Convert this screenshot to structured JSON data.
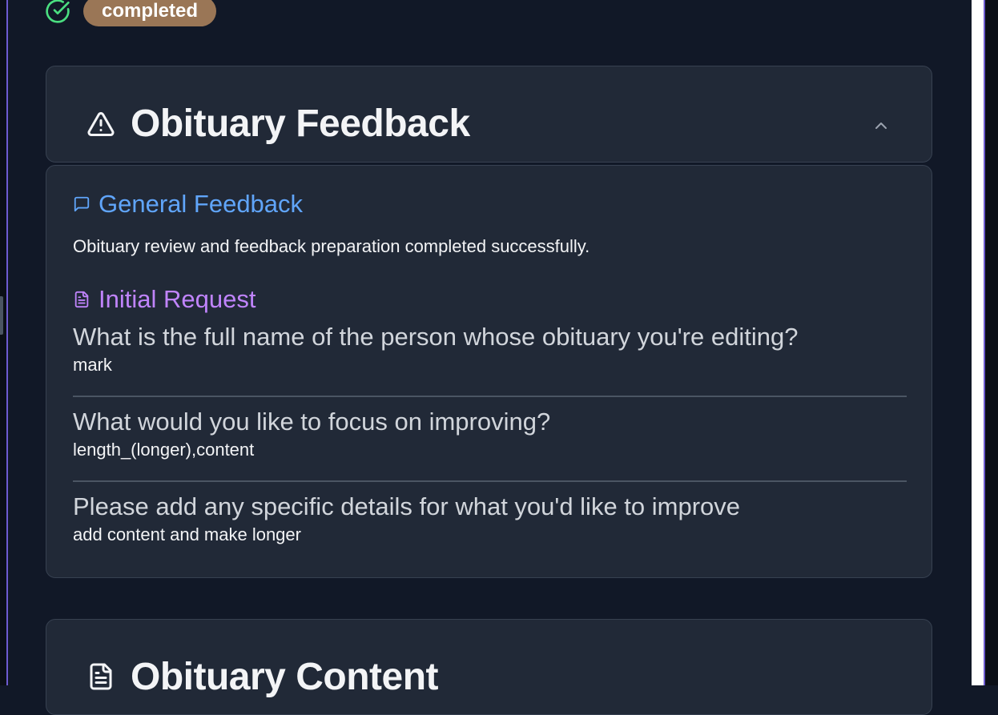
{
  "status": {
    "icon": "circle-check-icon",
    "label": "completed",
    "colors": {
      "check": "#4ade80",
      "pill": "#9a7656"
    }
  },
  "feedback_card": {
    "icon": "warning-triangle-icon",
    "title": "Obituary Feedback",
    "toggle_icon": "chevron-up-icon"
  },
  "general_feedback": {
    "icon": "message-square-icon",
    "title": "General Feedback",
    "text": "Obituary review and feedback preparation completed successfully.",
    "color": "#60a5fa"
  },
  "initial_request": {
    "icon": "file-text-icon",
    "title": "Initial Request",
    "color": "#c084fc",
    "items": [
      {
        "question": "What is the full name of the person whose obituary you're editing?",
        "answer": "mark"
      },
      {
        "question": "What would you like to focus on improving?",
        "answer": "length_(longer),content"
      },
      {
        "question": "Please add any specific details for what you'd like to improve",
        "answer": "add content and make longer"
      }
    ]
  },
  "content_card": {
    "icon": "file-text-icon",
    "title": "Obituary Content"
  }
}
